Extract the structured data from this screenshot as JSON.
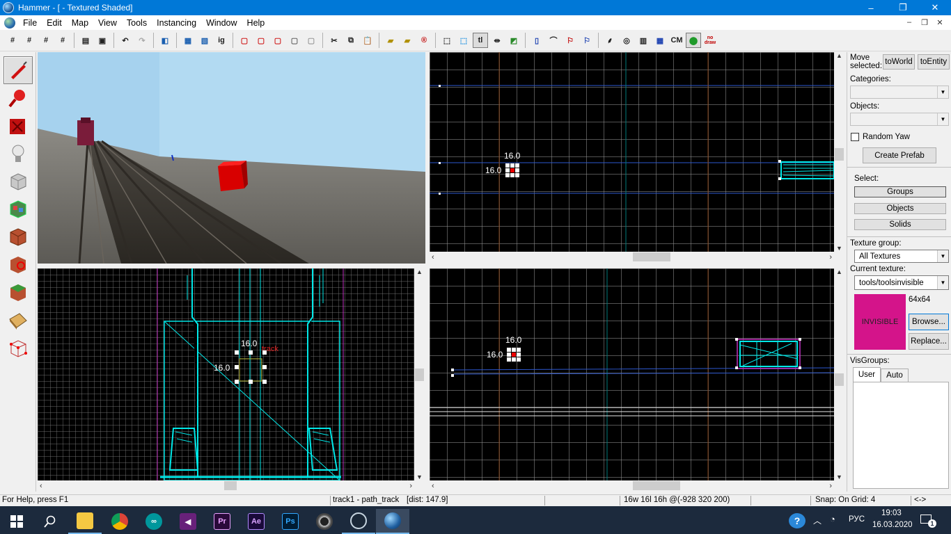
{
  "window": {
    "title": "Hammer - [ - Textured Shaded]",
    "controls": [
      "–",
      "❐",
      "✕"
    ]
  },
  "menu": {
    "items": [
      "File",
      "Edit",
      "Map",
      "View",
      "Tools",
      "Instancing",
      "Window",
      "Help"
    ],
    "mdi_controls": [
      "–",
      "❐",
      "✕"
    ]
  },
  "toolbar": {
    "text_buttons": {
      "tl": "tl",
      "ig": "ig",
      "cm": "CM",
      "nodraw": "no draw"
    }
  },
  "viewports": {
    "top": {
      "size_h": "16.0",
      "size_v": "16.0"
    },
    "side": {
      "size_h": "16.0",
      "size_v": "16.0",
      "entity_label": "track"
    },
    "front": {
      "size_h": "16.0",
      "size_v": "16.0"
    }
  },
  "right_panel": {
    "move_selected_label": "Move\nselected:",
    "to_world": "toWorld",
    "to_entity": "toEntity",
    "categories_label": "Categories:",
    "objects_label": "Objects:",
    "random_yaw": "Random Yaw",
    "create_prefab": "Create Prefab",
    "select_label": "Select:",
    "select_buttons": [
      "Groups",
      "Objects",
      "Solids"
    ],
    "texture_group_label": "Texture group:",
    "texture_group_value": "All Textures",
    "current_texture_label": "Current texture:",
    "current_texture_value": "tools/toolsinvisible",
    "texture_size": "64x64",
    "texture_preview_text": "INVISIBLE",
    "browse": "Browse...",
    "replace": "Replace...",
    "visgroups_label": "VisGroups:",
    "visgroup_tabs": [
      "User",
      "Auto"
    ]
  },
  "statusbar": {
    "help": "For Help, press F1",
    "selection": "track1 - path_track",
    "dist": "[dist: 147.9]",
    "dims": "16w 16l 16h @(-928 320 200)",
    "snap": "Snap: On Grid: 4",
    "arrows": "<->"
  },
  "taskbar": {
    "language": "РУС",
    "time": "19:03",
    "date": "16.03.2020",
    "notifications": "1",
    "apps": [
      "File Explorer",
      "Chrome",
      "Arduino",
      "Visual Studio",
      "Premiere Pro",
      "After Effects",
      "Photoshop",
      "Cinema 4D",
      "Steam",
      "Hammer"
    ],
    "app_glyphs": {
      "premiere": "Pr",
      "aftereffects": "Ae",
      "photoshop": "Ps"
    }
  },
  "colors": {
    "titlebar": "#0078d7",
    "wireframe": "#00e8e8",
    "selection": "#e00000",
    "texture_preview": "#d4148a",
    "taskbar": "#1c2a3d"
  }
}
